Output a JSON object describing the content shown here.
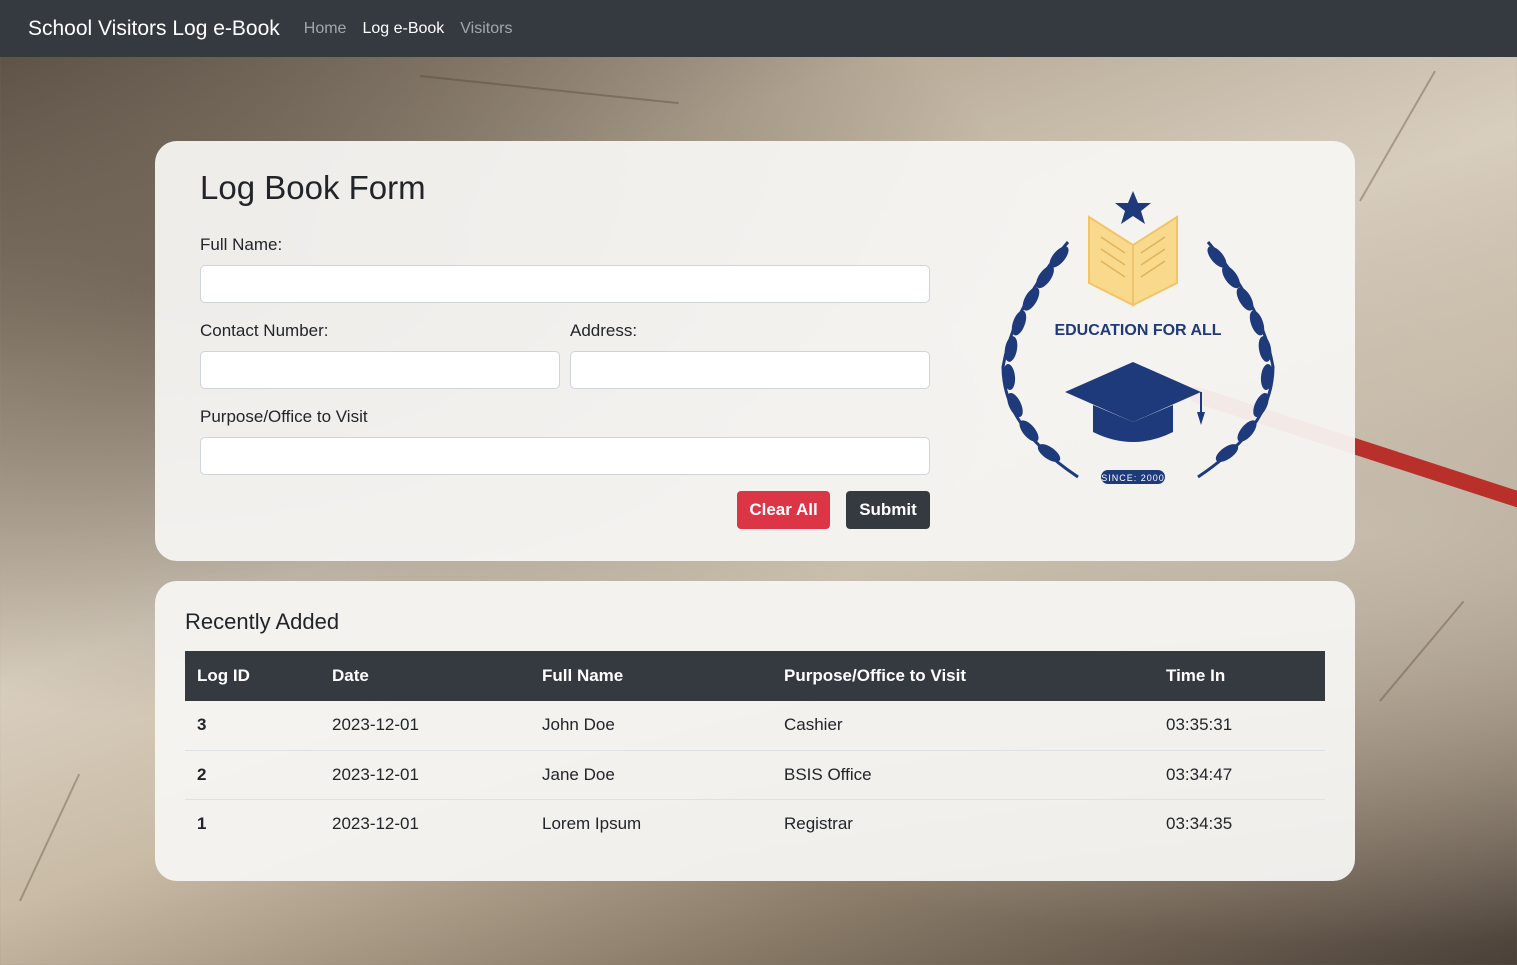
{
  "navbar": {
    "brand": "School Visitors Log e-Book",
    "links": [
      {
        "label": "Home"
      },
      {
        "label": "Log e-Book"
      },
      {
        "label": "Visitors"
      }
    ]
  },
  "form": {
    "title": "Log Book Form",
    "full_name_label": "Full Name:",
    "full_name_value": "",
    "contact_label": "Contact Number:",
    "contact_value": "",
    "address_label": "Address:",
    "address_value": "",
    "purpose_label": "Purpose/Office to Visit",
    "purpose_value": "",
    "clear_label": "Clear All",
    "submit_label": "Submit"
  },
  "logo": {
    "text": "EDUCATION FOR ALL",
    "since": "SINCE: 2000",
    "color": "#1e3a7b",
    "book_color": "#f9d98c"
  },
  "recent": {
    "title": "Recently Added",
    "headers": [
      "Log ID",
      "Date",
      "Full Name",
      "Purpose/Office to Visit",
      "Time In"
    ],
    "rows": [
      {
        "id": "3",
        "date": "2023-12-01",
        "name": "John Doe",
        "purpose": "Cashier",
        "time": "03:35:31"
      },
      {
        "id": "2",
        "date": "2023-12-01",
        "name": "Jane Doe",
        "purpose": "BSIS Office",
        "time": "03:34:47"
      },
      {
        "id": "1",
        "date": "2023-12-01",
        "name": "Lorem Ipsum",
        "purpose": "Registrar",
        "time": "03:34:35"
      }
    ]
  }
}
